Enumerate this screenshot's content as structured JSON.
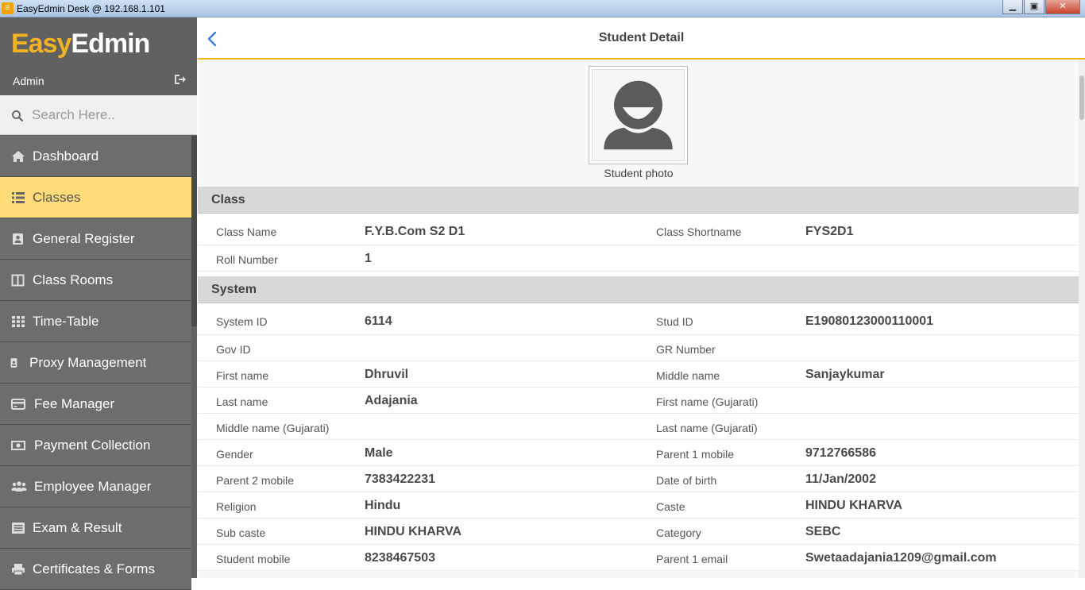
{
  "window": {
    "title": "EasyEdmin Desk @ 192.168.1.101"
  },
  "brand": {
    "easy": "Easy",
    "edmin": "Edmin"
  },
  "user": {
    "name": "Admin"
  },
  "search": {
    "placeholder": "Search Here.."
  },
  "menu": [
    {
      "label": "Dashboard",
      "icon": "home-icon"
    },
    {
      "label": "Classes",
      "icon": "list-icon",
      "active": true
    },
    {
      "label": "General Register",
      "icon": "contact-card-icon"
    },
    {
      "label": "Class Rooms",
      "icon": "columns-icon"
    },
    {
      "label": "Time-Table",
      "icon": "grid-icon"
    },
    {
      "label": "Proxy Management",
      "icon": "id-badge-icon"
    },
    {
      "label": "Fee Manager",
      "icon": "credit-card-icon"
    },
    {
      "label": "Payment Collection",
      "icon": "money-icon"
    },
    {
      "label": "Employee Manager",
      "icon": "users-icon"
    },
    {
      "label": "Exam & Result",
      "icon": "list-alt-icon"
    },
    {
      "label": "Certificates & Forms",
      "icon": "print-icon"
    }
  ],
  "header": {
    "title": "Student Detail"
  },
  "photo": {
    "caption": "Student photo"
  },
  "class_section": {
    "title": "Class",
    "rows": [
      {
        "l1": "Class Name",
        "v1": "F.Y.B.Com S2 D1",
        "l2": "Class Shortname",
        "v2": "FYS2D1"
      },
      {
        "l1": "Roll Number",
        "v1": "1",
        "l2": "",
        "v2": ""
      }
    ]
  },
  "system_section": {
    "title": "System",
    "rows": [
      {
        "l1": "System ID",
        "v1": "6114",
        "l2": "Stud ID",
        "v2": "E19080123000110001"
      },
      {
        "l1": "Gov ID",
        "v1": "",
        "l2": "GR Number",
        "v2": ""
      },
      {
        "l1": "First name",
        "v1": "Dhruvil",
        "l2": "Middle name",
        "v2": "Sanjaykumar"
      },
      {
        "l1": "Last name",
        "v1": "Adajania",
        "l2": "First name (Gujarati)",
        "v2": ""
      },
      {
        "l1": "Middle name (Gujarati)",
        "v1": "",
        "l2": "Last name (Gujarati)",
        "v2": ""
      },
      {
        "l1": "Gender",
        "v1": "Male",
        "l2": "Parent 1 mobile",
        "v2": "9712766586"
      },
      {
        "l1": "Parent 2 mobile",
        "v1": "7383422231",
        "l2": "Date of birth",
        "v2": "11/Jan/2002"
      },
      {
        "l1": "Religion",
        "v1": "Hindu",
        "l2": "Caste",
        "v2": "HINDU KHARVA"
      },
      {
        "l1": "Sub caste",
        "v1": "HINDU KHARVA",
        "l2": "Category",
        "v2": "SEBC"
      },
      {
        "l1": "Student mobile",
        "v1": "8238467503",
        "l2": "Parent 1 email",
        "v2": "Swetaadajania1209@gmail.com"
      }
    ]
  }
}
